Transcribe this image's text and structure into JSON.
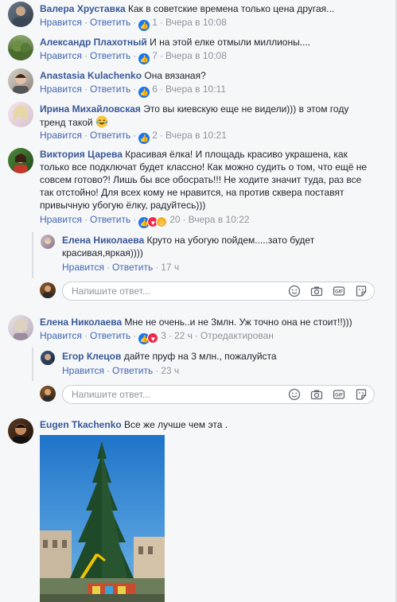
{
  "colors": {
    "name": "#385898",
    "link": "#4267b2",
    "meta": "#90949c",
    "like": "#1877f2",
    "love": "#f0284a",
    "haha": "#f7b125"
  },
  "reply_input": {
    "placeholder": "Напишите ответ..."
  },
  "actions": {
    "like": "Нравится",
    "reply": "Ответить"
  },
  "comments": [
    {
      "name": "Валера Хруставка",
      "text": "Как в советские времена только цена другая...",
      "reactions": "1",
      "time": "Вчера в 10:08",
      "avatar": "person-photo"
    },
    {
      "name": "Александр Плахотный",
      "text": "И на этой елке отмыли миллионы....",
      "reactions": "7",
      "time": "Вчера в 10:08",
      "avatar": "landscape-photo"
    },
    {
      "name": "Anastasia Kulachenko",
      "text": "Она вязаная?",
      "reactions": "6",
      "time": "Вчера в 10:11",
      "avatar": "person-photo"
    },
    {
      "name": "Ирина Михайловская",
      "text_line1": "Это вы киевскую еще не видели))) в этом году",
      "text_line2": "тренд такой",
      "emoji": "laughing-emoji",
      "reactions": "2",
      "time": "Вчера в 10:21",
      "avatar": "person-photo"
    },
    {
      "name": "Виктория Царева",
      "text_line1": "Красивая ёлка! И площадь красиво украшена, как",
      "text_line2": "только все подключат будет классно! Как можно судить о том, что ещё не",
      "text_line3": "совсем готово?! Лишь бы все обосрать!!! Не ходите значит туда, раз все",
      "text_line4": "так отстойно! Для всех кому не нравится, на против сквера поставят",
      "text_line5": "привычную убогую ёлку, радуйтесь)))",
      "reactions": "20",
      "time": "Вчера в 10:22",
      "avatar": "person-photo",
      "replies": [
        {
          "name": "Елена Николаева",
          "text_line1": "Круто на убогую пойдем.....зато будет",
          "text_line2": "красивая,яркая))))",
          "time": "17 ч",
          "avatar": "person-photo"
        }
      ]
    },
    {
      "name": "Елена Николаева",
      "text": "Мне не очень..и не 3млн. Уж точно она не стоит!!)))",
      "reactions": "3",
      "time": "22 ч",
      "edited": "Отредактирован",
      "avatar": "person-photo",
      "replies": [
        {
          "name": "Егор Клецов",
          "text": "дайте пруф на 3 млн., пожалуйста",
          "time": "23 ч",
          "avatar": "person-photo"
        }
      ]
    },
    {
      "name": "Eugen Tkachenko",
      "text": "Все же лучше чем эта .",
      "avatar": "person-photo",
      "attachment": "photo-christmas-tree-construction"
    }
  ]
}
